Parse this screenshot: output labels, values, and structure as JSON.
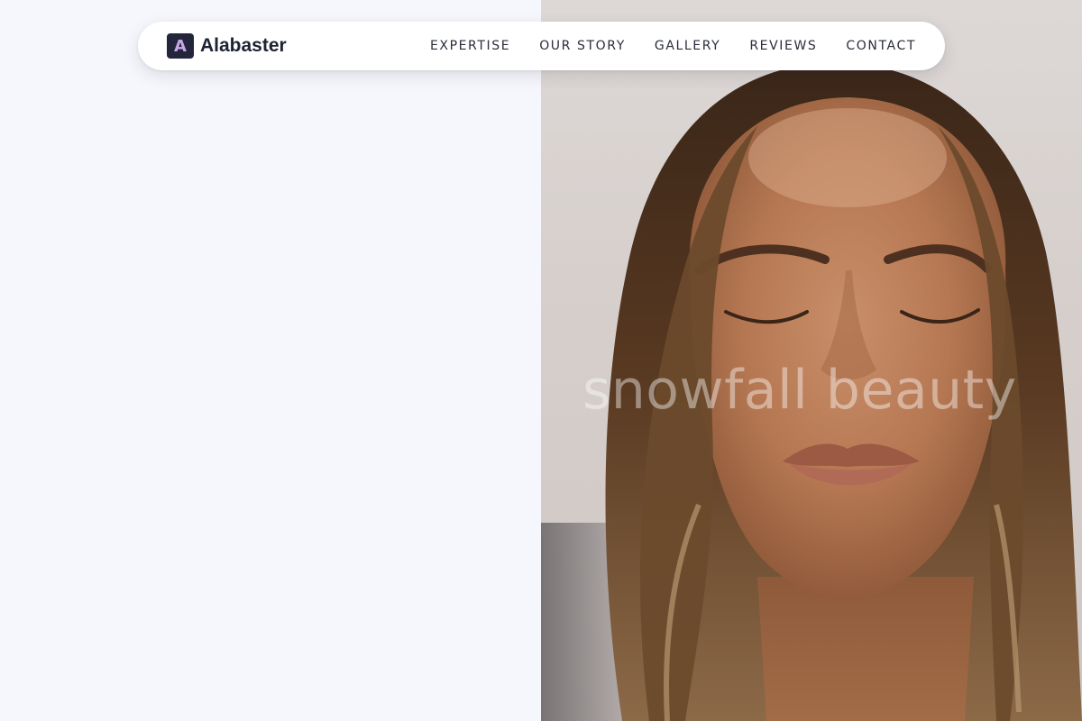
{
  "brand": {
    "mark": "A",
    "name": "Alabaster"
  },
  "nav": {
    "items": [
      {
        "label": "EXPERTISE"
      },
      {
        "label": "OUR STORY"
      },
      {
        "label": "GALLERY"
      },
      {
        "label": "REVIEWS"
      },
      {
        "label": "CONTACT"
      }
    ]
  },
  "hero": {
    "watermark": "snowfall beauty",
    "image_subject": "portrait-woman-closed-eyes"
  },
  "colors": {
    "page_background": "#f6f7fc",
    "navbar_background": "#ffffff",
    "brand_mark_bg": "#23263a",
    "brand_mark_fg": "#c9a6e6",
    "text_dark": "#1f2233"
  }
}
